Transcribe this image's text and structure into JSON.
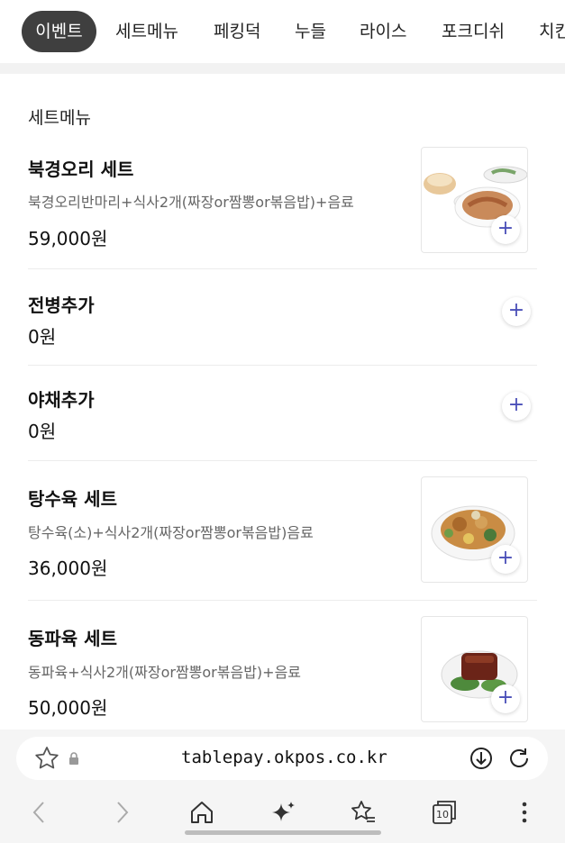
{
  "tabs": [
    {
      "label": "이벤트",
      "active": true
    },
    {
      "label": "세트메뉴"
    },
    {
      "label": "페킹덕"
    },
    {
      "label": "누들"
    },
    {
      "label": "라이스"
    },
    {
      "label": "포크디쉬"
    },
    {
      "label": "치킨"
    }
  ],
  "section": {
    "title": "세트메뉴"
  },
  "items": [
    {
      "name": "북경오리 세트",
      "desc": "북경오리반마리+식사2개(짜장or짬뽕or볶음밥)+음료",
      "price": "59,000원",
      "image": "peking-duck-set"
    },
    {
      "name": "전병추가",
      "desc": "",
      "price": "0원"
    },
    {
      "name": "야채추가",
      "desc": "",
      "price": "0원"
    },
    {
      "name": "탕수육 세트",
      "desc": "탕수육(소)+식사2개(짜장or짬뽕or볶음밥)음료",
      "price": "36,000원",
      "image": "sweet-sour-pork-plate"
    },
    {
      "name": "동파육 세트",
      "desc": "동파육+식사2개(짜장or짬뽕or볶음밥)+음료",
      "price": "50,000원",
      "image": "dongpo-pork-plate"
    }
  ],
  "plus_symbol": "+",
  "browser": {
    "url": "tablepay.okpos.co.kr",
    "tab_count": "10",
    "icons": [
      "star-icon",
      "lock-icon",
      "download-icon",
      "reload-icon",
      "back-icon",
      "forward-icon",
      "home-icon",
      "sparkle-icon",
      "bookmarks-icon",
      "tabs-icon",
      "more-icon"
    ]
  },
  "colors": {
    "accent": "#4a4fb8",
    "active_tab_bg": "#3f3f3f"
  }
}
